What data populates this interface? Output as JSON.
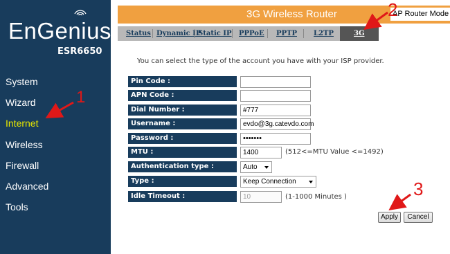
{
  "brand": {
    "logo_text": "EnGenius",
    "model": "ESR6650"
  },
  "header": {
    "title": "3G Wireless Router",
    "mode_select": "AP Router Mode"
  },
  "tabs": [
    {
      "label": "Status"
    },
    {
      "label": "Dynamic IP"
    },
    {
      "label": "Static IP"
    },
    {
      "label": "PPPoE"
    },
    {
      "label": "PPTP"
    },
    {
      "label": "L2TP"
    },
    {
      "label": "3G",
      "active": true
    }
  ],
  "sidebar": {
    "items": [
      {
        "label": "System"
      },
      {
        "label": "Wizard"
      },
      {
        "label": "Internet",
        "active": true
      },
      {
        "label": "Wireless"
      },
      {
        "label": "Firewall"
      },
      {
        "label": "Advanced"
      },
      {
        "label": "Tools"
      }
    ]
  },
  "main": {
    "description": "You can select the type of the account you have with your ISP provider.",
    "fields": {
      "pin_code": {
        "label": "Pin Code :",
        "value": ""
      },
      "apn_code": {
        "label": "APN Code :",
        "value": ""
      },
      "dial_number": {
        "label": "Dial Number :",
        "value": "#777"
      },
      "username": {
        "label": "Username :",
        "value": "evdo@3g.catevdo.com"
      },
      "password": {
        "label": "Password :",
        "value": "•••••••"
      },
      "mtu": {
        "label": "MTU :",
        "value": "1400",
        "hint": "(512<=MTU Value <=1492)"
      },
      "auth_type": {
        "label": "Authentication type :",
        "value": "Auto"
      },
      "type": {
        "label": "Type :",
        "value": "Keep Connection"
      },
      "idle_timeout": {
        "label": "Idle Timeout :",
        "value": "10",
        "hint": "(1-1000 Minutes )"
      }
    },
    "apply_label": "Apply",
    "cancel_label": "Cancel"
  },
  "annotations": {
    "one": "1",
    "two": "2",
    "three": "3"
  },
  "colors": {
    "sidebar": "#183c5c",
    "header": "#f0a040",
    "active_nav": "#e6e600",
    "annotation": "#e01818"
  }
}
